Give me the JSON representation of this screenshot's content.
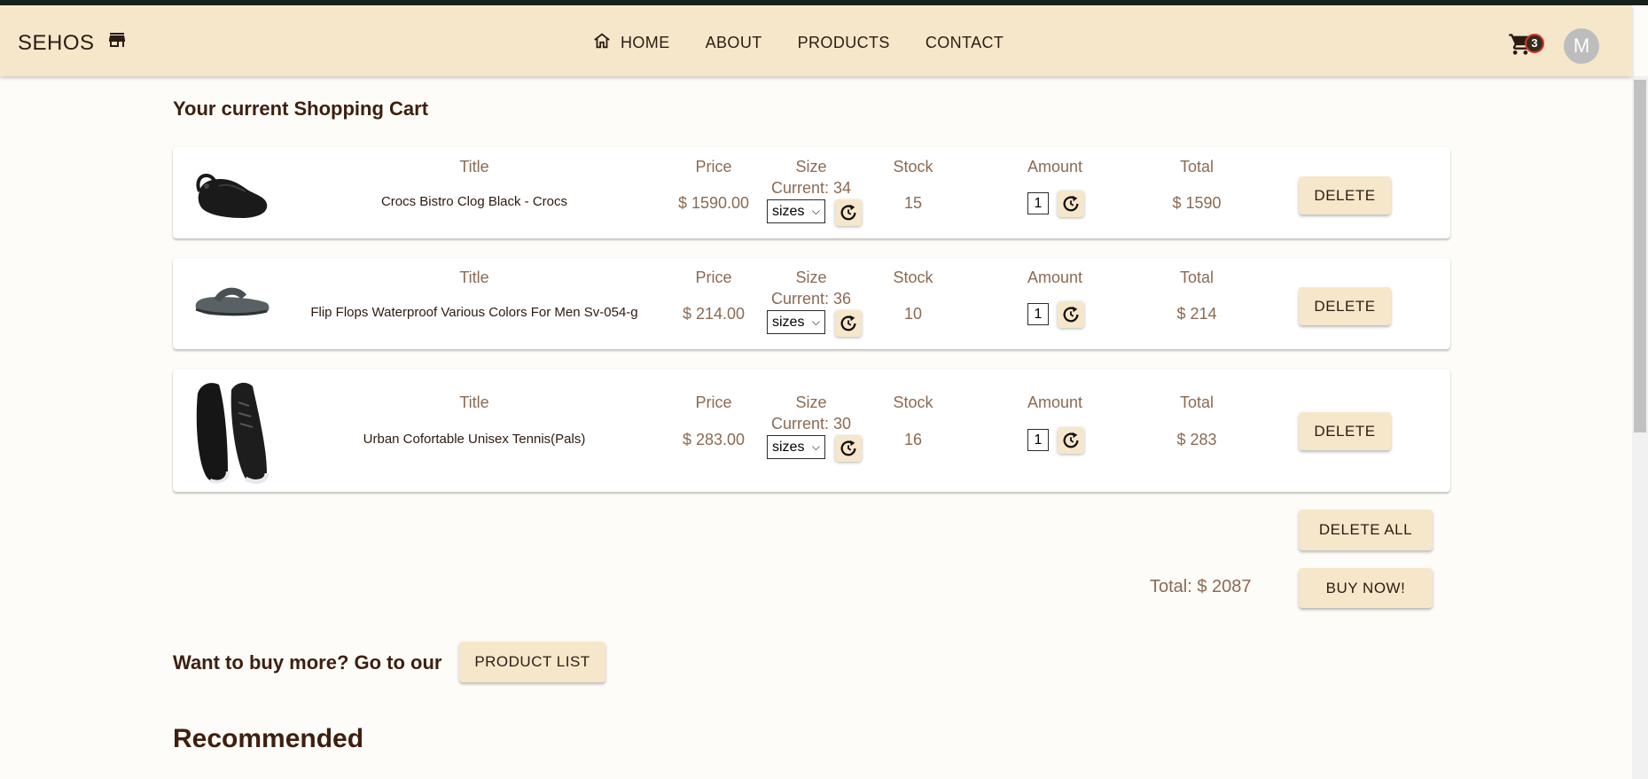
{
  "navbar": {
    "brand": "SEHOS",
    "links": [
      {
        "label": "HOME"
      },
      {
        "label": "ABOUT"
      },
      {
        "label": "PRODUCTS"
      },
      {
        "label": "CONTACT"
      }
    ],
    "cart_count": "3",
    "avatar_initial": "M"
  },
  "cart": {
    "heading": "Your current Shopping Cart",
    "column_labels": {
      "title": "Title",
      "price": "Price",
      "size": "Size",
      "stock": "Stock",
      "amount": "Amount",
      "total": "Total"
    },
    "size_select_placeholder": "sizes",
    "delete_label": "DELETE",
    "items": [
      {
        "title": "Crocs Bistro Clog Black - Crocs",
        "price": "$ 1590.00",
        "current_size": "Current: 34",
        "stock": "15",
        "amount": "1",
        "total": "$ 1590"
      },
      {
        "title": "Flip Flops Waterproof Various Colors For Men Sv-054-g",
        "price": "$ 214.00",
        "current_size": "Current: 36",
        "stock": "10",
        "amount": "1",
        "total": "$ 214"
      },
      {
        "title": "Urban Cofortable Unisex Tennis(Pals)",
        "price": "$ 283.00",
        "current_size": "Current: 30",
        "stock": "16",
        "amount": "1",
        "total": "$ 283"
      }
    ],
    "delete_all_label": "DELETE ALL",
    "total_text": "Total: $ 2087",
    "buy_label": "BUY NOW!"
  },
  "more": {
    "text": "Want to buy more? Go to our",
    "button_label": "PRODUCT LIST"
  },
  "recommended_heading": "Recommended",
  "colors": {
    "navbar_bg": "#f6e7cb",
    "button_bg": "#f6e7cb",
    "heading_text": "#3d1f10",
    "muted_text": "#8b6a52",
    "badge_border": "#d6342a"
  }
}
